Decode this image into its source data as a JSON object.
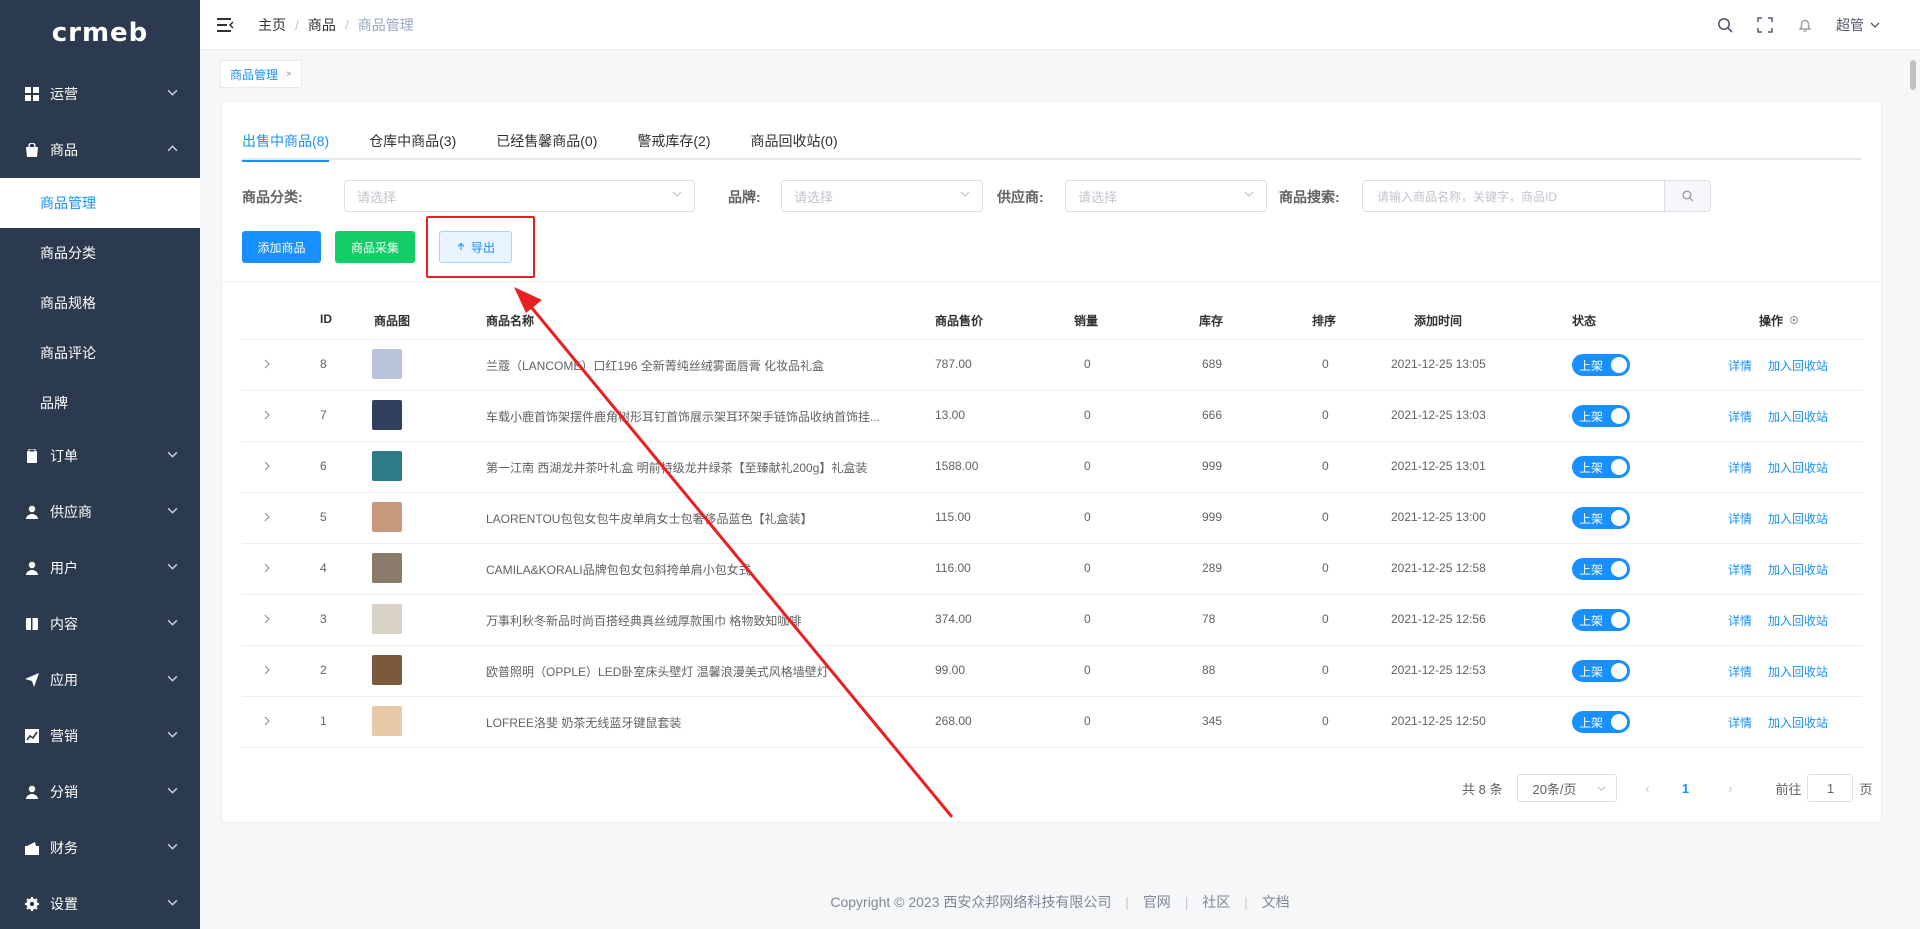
{
  "sidebar": {
    "logo": "crmeb",
    "groups": [
      {
        "label": "运营",
        "icon": "grid-icon"
      },
      {
        "label": "商品",
        "icon": "shopping-bag-icon"
      },
      {
        "label": "订单",
        "icon": "clipboard-icon"
      },
      {
        "label": "供应商",
        "icon": "user-icon"
      },
      {
        "label": "用户",
        "icon": "user-icon"
      },
      {
        "label": "内容",
        "icon": "book-icon"
      },
      {
        "label": "应用",
        "icon": "send-icon"
      },
      {
        "label": "营销",
        "icon": "chart-icon"
      },
      {
        "label": "分销",
        "icon": "user-icon"
      },
      {
        "label": "财务",
        "icon": "finance-icon"
      },
      {
        "label": "设置",
        "icon": "gear-icon"
      }
    ],
    "sub_items": [
      "商品管理",
      "商品分类",
      "商品规格",
      "商品评论",
      "品牌"
    ]
  },
  "header": {
    "breadcrumb": [
      "主页",
      "商品",
      "商品管理"
    ],
    "user": "超管"
  },
  "tagbar": {
    "tag": "商品管理",
    "close": "×"
  },
  "tabs": [
    "出售中商品(8)",
    "仓库中商品(3)",
    "已经售馨商品(0)",
    "警戒库存(2)",
    "商品回收站(0)"
  ],
  "filters": {
    "category_label": "商品分类:",
    "category_placeholder": "请选择",
    "brand_label": "品牌:",
    "brand_placeholder": "请选择",
    "supplier_label": "供应商:",
    "supplier_placeholder": "请选择",
    "search_label": "商品搜索:",
    "search_placeholder": "请输入商品名称，关键字，商品ID"
  },
  "actions": {
    "add": "添加商品",
    "collect": "商品采集",
    "export": "导出"
  },
  "table": {
    "headers": {
      "id": "ID",
      "image": "商品图",
      "name": "商品名称",
      "price": "商品售价",
      "sales": "销量",
      "stock": "库存",
      "sort": "排序",
      "time": "添加时间",
      "status": "状态",
      "ops": "操作"
    },
    "rows": [
      {
        "id": "8",
        "name": "兰蔻（LANCOME）口红196 全新菁纯丝绒雾面唇膏 化妆品礼盒",
        "price": "787.00",
        "sales": "0",
        "stock": "689",
        "sort": "0",
        "time": "2021-12-25 13:05",
        "status": "上架",
        "thumb": "#b9c3da"
      },
      {
        "id": "7",
        "name": "车载小鹿首饰架摆件鹿角树形耳钉首饰展示架耳环架手链饰品收纳首饰挂...",
        "price": "13.00",
        "sales": "0",
        "stock": "666",
        "sort": "0",
        "time": "2021-12-25 13:03",
        "status": "上架",
        "thumb": "#2f3f5c"
      },
      {
        "id": "6",
        "name": "第一江南 西湖龙井茶叶礼盒 明前特级龙井绿茶【至臻献礼200g】礼盒装",
        "price": "1588.00",
        "sales": "0",
        "stock": "999",
        "sort": "0",
        "time": "2021-12-25 13:01",
        "status": "上架",
        "thumb": "#2f7a87"
      },
      {
        "id": "5",
        "name": "LAORENTOU包包女包牛皮单肩女士包奢侈品蓝色【礼盒装】",
        "price": "115.00",
        "sales": "0",
        "stock": "999",
        "sort": "0",
        "time": "2021-12-25 13:00",
        "status": "上架",
        "thumb": "#c79a7e"
      },
      {
        "id": "4",
        "name": "CAMILA&KORALI品牌包包女包斜挎单肩小包女式",
        "price": "116.00",
        "sales": "0",
        "stock": "289",
        "sort": "0",
        "time": "2021-12-25 12:58",
        "status": "上架",
        "thumb": "#8a7a6a"
      },
      {
        "id": "3",
        "name": "万事利秋冬新品时尚百搭经典真丝绒厚款围巾 格物致知咖啡",
        "price": "374.00",
        "sales": "0",
        "stock": "78",
        "sort": "0",
        "time": "2021-12-25 12:56",
        "status": "上架",
        "thumb": "#d8d3c6"
      },
      {
        "id": "2",
        "name": "欧普照明（OPPLE）LED卧室床头壁灯 温馨浪漫美式风格墙壁灯",
        "price": "99.00",
        "sales": "0",
        "stock": "88",
        "sort": "0",
        "time": "2021-12-25 12:53",
        "status": "上架",
        "thumb": "#7a5a3a"
      },
      {
        "id": "1",
        "name": "LOFREE洛斐 奶茶无线蓝牙键鼠套装",
        "price": "268.00",
        "sales": "0",
        "stock": "345",
        "sort": "0",
        "time": "2021-12-25 12:50",
        "status": "上架",
        "thumb": "#e8c9a8"
      }
    ],
    "op_detail": "详情",
    "op_recycle": "加入回收站"
  },
  "pagination": {
    "total": "共 8 条",
    "page_size": "20条/页",
    "current": "1",
    "goto_label": "前往",
    "goto_value": "1",
    "page_suffix": "页"
  },
  "footer": {
    "copyright": "Copyright © 2023 西安众邦网络科技有限公司",
    "links": [
      "官网",
      "社区",
      "文档"
    ]
  },
  "colors": {
    "sidebar_bg": "#2b3a4f",
    "accent": "#1890ff",
    "success": "#13ce66",
    "annotation": "#e82020"
  }
}
